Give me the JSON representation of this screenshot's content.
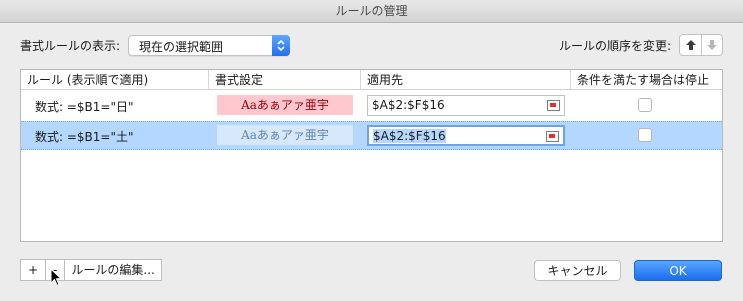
{
  "window": {
    "title": "ルールの管理"
  },
  "show": {
    "label": "書式ルールの表示:",
    "selected": "現在の選択範囲"
  },
  "order": {
    "label": "ルールの順序を変更:"
  },
  "table": {
    "headers": [
      "ルール (表示順で適用)",
      "書式設定",
      "適用先",
      "条件を満たす場合は停止"
    ],
    "rows": [
      {
        "rule": "数式: =$B1=\"日\"",
        "preview": "Aaあぁアァ亜宇",
        "applies_to": "$A$2:$F$16",
        "stop": false
      },
      {
        "rule": "数式: =$B1=\"土\"",
        "preview": "Aaあぁアァ亜宇",
        "applies_to": "$A$2:$F$16",
        "stop": false
      }
    ],
    "colors": {
      "pink_bg": "#ffc7ce",
      "pink_text": "#9c0006",
      "selected_row": "#b3d7ff"
    }
  },
  "footer": {
    "add": "+",
    "remove": "-",
    "edit": "ルールの編集...",
    "cancel": "キャンセル",
    "ok": "OK"
  }
}
